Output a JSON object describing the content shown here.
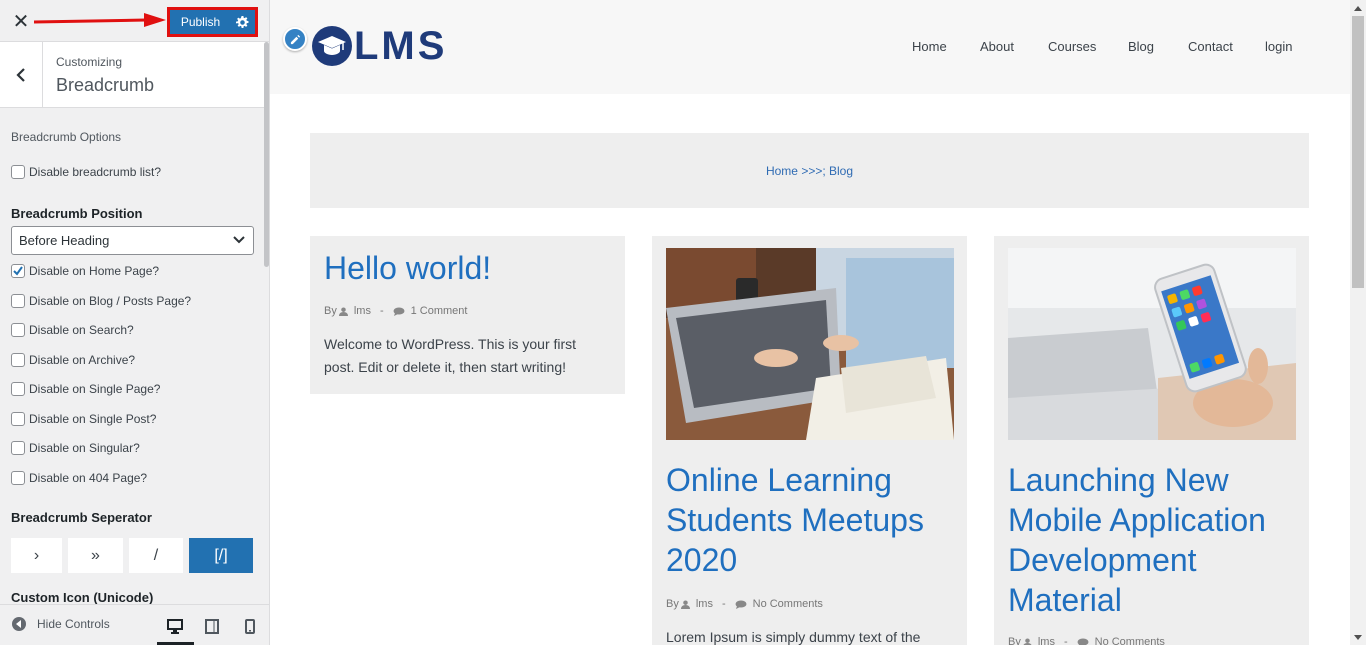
{
  "customizer": {
    "publish_label": "Publish",
    "customizing_label": "Customizing",
    "section_title": "Breadcrumb",
    "options_label": "Breadcrumb Options",
    "disable_list_label": "Disable breadcrumb list?",
    "position_label": "Breadcrumb Position",
    "position_value": "Before Heading",
    "checkboxes": [
      {
        "label": "Disable on Home Page?",
        "checked": true
      },
      {
        "label": "Disable on Blog / Posts Page?",
        "checked": false
      },
      {
        "label": "Disable on Search?",
        "checked": false
      },
      {
        "label": "Disable on Archive?",
        "checked": false
      },
      {
        "label": "Disable on Single Page?",
        "checked": false
      },
      {
        "label": "Disable on Single Post?",
        "checked": false
      },
      {
        "label": "Disable on Singular?",
        "checked": false
      },
      {
        "label": "Disable on 404 Page?",
        "checked": false
      }
    ],
    "separator_label": "Breadcrumb Seperator",
    "separators": [
      "›",
      "»",
      "/",
      "[/]"
    ],
    "separator_active": "[/]",
    "custom_icon_label": "Custom Icon (Unicode)",
    "hide_controls_label": "Hide Controls",
    "active_device": "desktop"
  },
  "site": {
    "logo_text": "LMS",
    "nav": [
      "Home",
      "About",
      "Courses",
      "Blog",
      "Contact",
      "login"
    ],
    "breadcrumb": "Home >>>; Blog"
  },
  "posts": [
    {
      "title": "Hello world!",
      "by": "By",
      "author": "lms",
      "comments": "1 Comment",
      "excerpt_1": "Welcome to WordPress. This is your first",
      "excerpt_2": "post. Edit or delete it, then start writing!"
    },
    {
      "title_1": "Online Learning",
      "title_2": "Students Meetups",
      "title_3": "2020",
      "by": "By",
      "author": "lms",
      "comments": "No Comments",
      "excerpt_1": "Lorem Ipsum is simply dummy text of the"
    },
    {
      "title_1": "Launching New",
      "title_2": "Mobile Application",
      "title_3": "Development",
      "title_4": "Material",
      "by": "By",
      "author": "lms",
      "comments": "No Comments"
    }
  ],
  "colors": {
    "accent": "#2271b1",
    "link": "#1f6fbf",
    "highlight": "#e01010"
  }
}
